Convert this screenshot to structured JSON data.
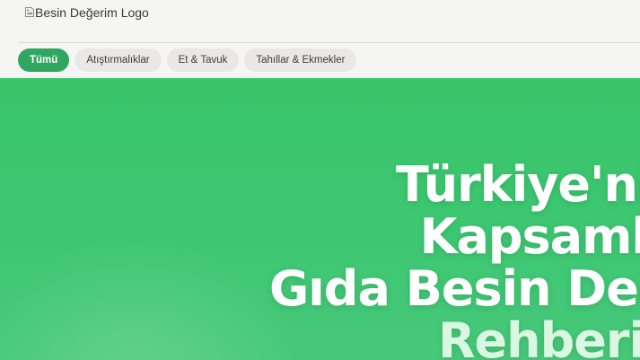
{
  "header": {
    "logo_alt": "Besin Değerim Logo"
  },
  "categories": [
    {
      "label": "Tümü",
      "active": true
    },
    {
      "label": "Atıştırmalıklar",
      "active": false
    },
    {
      "label": "Et & Tavuk",
      "active": false
    },
    {
      "label": "Tahıllar & Ekmekler",
      "active": false
    }
  ],
  "hero": {
    "title_lines": [
      "Türkiye'nin",
      "Kapsamlı",
      "Gıda Besin Değerleri",
      "Rehberi"
    ]
  },
  "colors": {
    "accent": "#2fa760",
    "hero_bg": "#3cc56e"
  }
}
